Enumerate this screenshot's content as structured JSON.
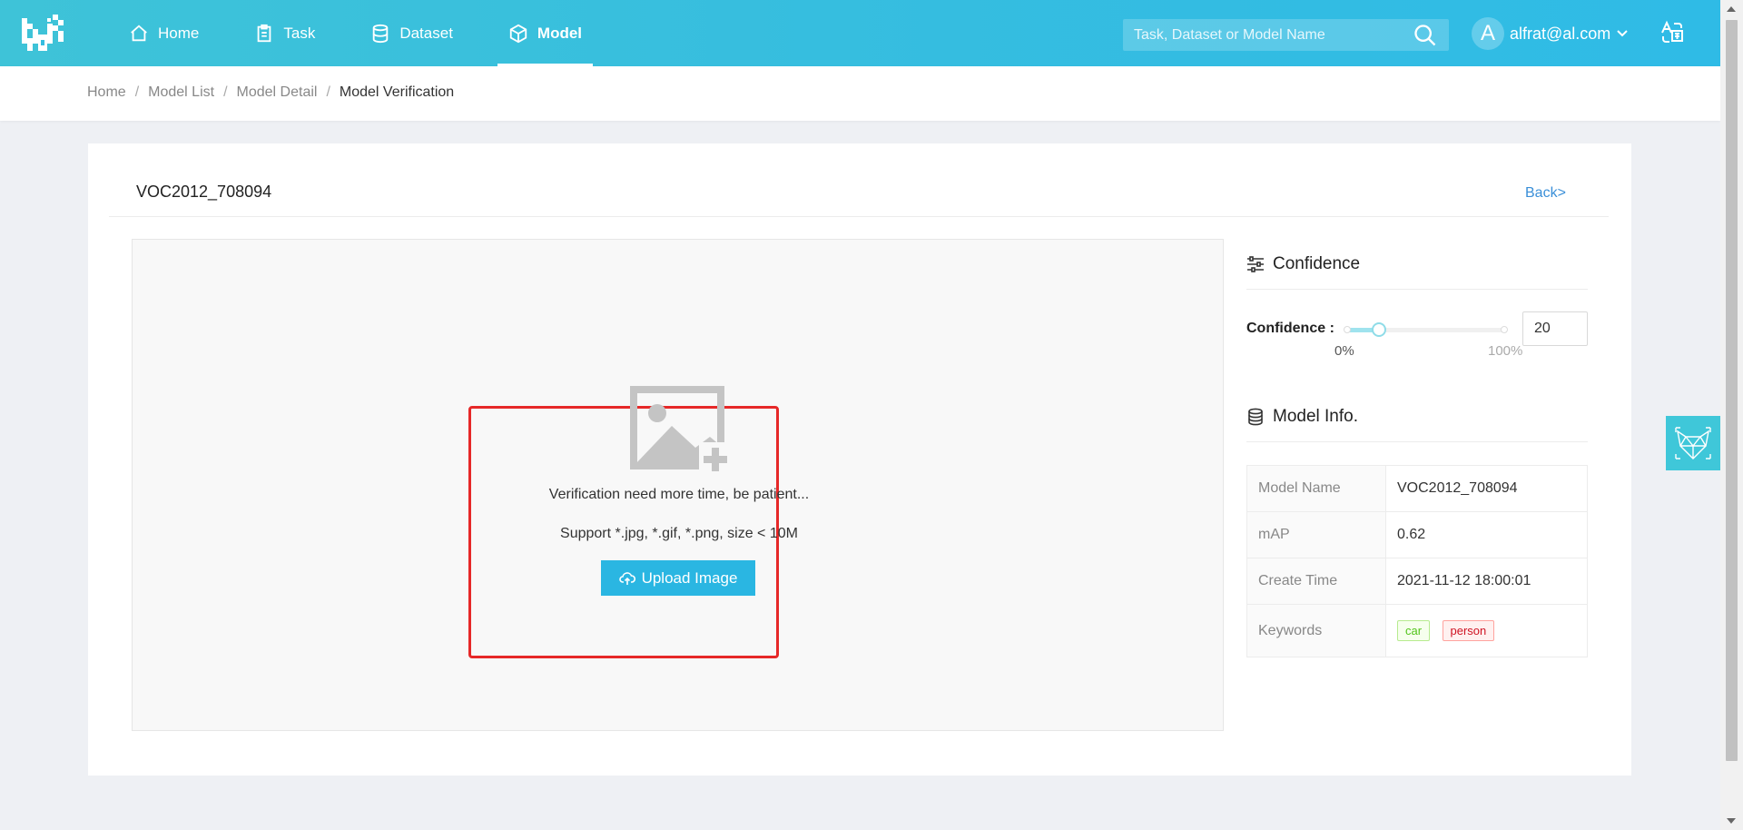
{
  "header": {
    "nav": [
      {
        "label": "Home",
        "icon": "home-icon"
      },
      {
        "label": "Task",
        "icon": "clipboard-icon"
      },
      {
        "label": "Dataset",
        "icon": "database-icon"
      },
      {
        "label": "Model",
        "icon": "cube-icon",
        "active": true
      }
    ],
    "search_placeholder": "Task, Dataset or Model Name",
    "user_initial": "A",
    "user_email": "alfrat@al.com"
  },
  "breadcrumb": [
    "Home",
    "Model List",
    "Model Detail",
    "Model Verification"
  ],
  "page": {
    "title": "VOC2012_708094",
    "back": "Back>"
  },
  "upload": {
    "verify_text": "Verification need more time, be patient...",
    "support_text": "Support *.jpg, *.gif, *.png, size < 10M",
    "button": "Upload Image"
  },
  "confidence": {
    "section_title": "Confidence",
    "label": "Confidence :",
    "value": "20",
    "min_label": "0%",
    "max_label": "100%",
    "slider_fraction": 0.2
  },
  "model_info": {
    "section_title": "Model Info.",
    "rows": [
      {
        "key": "Model Name",
        "value": "VOC2012_708094"
      },
      {
        "key": "mAP",
        "value": "0.62"
      },
      {
        "key": "Create Time",
        "value": "2021-11-12 18:00:01"
      }
    ],
    "keywords_label": "Keywords",
    "keywords": [
      "car",
      "person"
    ]
  },
  "colors": {
    "header_accent": "#35bde0",
    "button": "#2ab6e2",
    "highlight": "#e62828",
    "link": "#3a8fd8"
  }
}
